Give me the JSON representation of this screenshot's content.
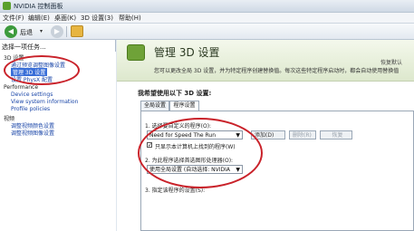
{
  "window": {
    "title": "NVIDIA 控制面板"
  },
  "menu": [
    "文件(F)",
    "编辑(E)",
    "桌面(K)",
    "3D 设置(3)",
    "帮助(H)"
  ],
  "toolbar": {
    "back_label": "后退"
  },
  "left": {
    "task_header": "选择一项任务...",
    "tree": [
      {
        "text": "3D 设置",
        "kind": "category"
      },
      {
        "text": "通过预览调整图像设置",
        "kind": "link"
      },
      {
        "text": "管理 3D 设置",
        "kind": "selected"
      },
      {
        "text": "设置 PhysX 配置",
        "kind": "link"
      },
      {
        "text": "Performance",
        "kind": "category"
      },
      {
        "text": "Device settings",
        "kind": "link"
      },
      {
        "text": "View system information",
        "kind": "link"
      },
      {
        "text": "Profile policies",
        "kind": "link"
      },
      {
        "text": "视频",
        "kind": "category"
      },
      {
        "text": "调整视频颜色设置",
        "kind": "link"
      },
      {
        "text": "调整视频图像设置",
        "kind": "link"
      }
    ]
  },
  "main": {
    "title": "管理 3D 设置",
    "restore": "恢复默认",
    "description": "您可以更改全局 3D 设置，并为特定程序创建替换值。每次这些特定程序启动时，都会自动使用替换值",
    "section_label": "我希望使用以下 3D 设置:",
    "tabs": [
      "全局设置",
      "程序设置"
    ],
    "step1_label": "1. 选择要自定义的程序(O):",
    "program_value": "Need for Speed  The Run",
    "add_button": "添加(D)",
    "remove_button": "删除(R)",
    "restore_button": "恢复",
    "checkbox_label": "只显示本计算机上找到的程序(W)",
    "checkbox_checked": true,
    "step2_label": "2. 为此程序选择首选图形处理器(O):",
    "gpu_value": "使用全局设置 (自动选择: NVIDIA",
    "step3_label": "3. 指定该程序的设置(S):"
  }
}
